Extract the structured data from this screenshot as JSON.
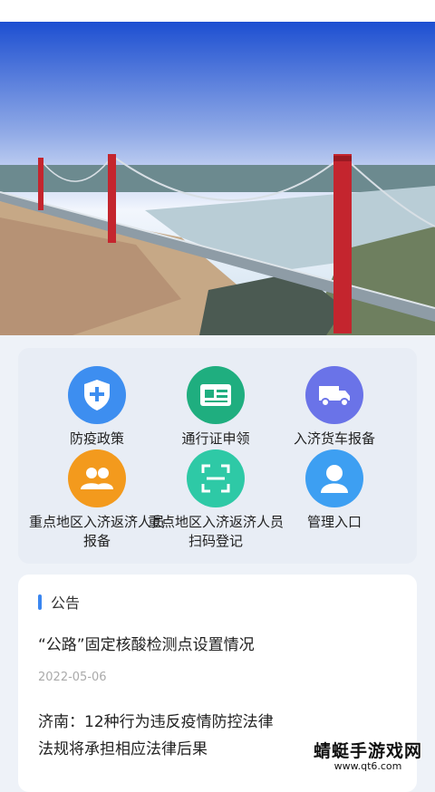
{
  "services": [
    {
      "label": "防疫政策",
      "icon": "shield-plus-icon",
      "color": "#3d8ef0"
    },
    {
      "label": "通行证申领",
      "icon": "id-card-icon",
      "color": "#1fae7f"
    },
    {
      "label": "入济货车报备",
      "icon": "truck-icon",
      "color": "#6a73e8"
    },
    {
      "label": "重点地区入济返济人员报备",
      "icon": "people-icon",
      "color": "#f39a1d"
    },
    {
      "label": "重点地区入济返济人员扫码登记",
      "icon": "scan-frame-icon",
      "color": "#2ec9a6"
    },
    {
      "label": "管理入口",
      "icon": "user-avatar-icon",
      "color": "#3d9ff2"
    }
  ],
  "notice": {
    "heading": "公告",
    "items": [
      {
        "title": "“公路”固定核酸检测点设置情况",
        "date": "2022-05-06"
      },
      {
        "title": "济南：12种行为违反疫情防控法律法规将承担相应法律后果"
      }
    ]
  },
  "watermark": {
    "main": "蜻蜓手游戏网",
    "sub": "www.qt6.com"
  }
}
